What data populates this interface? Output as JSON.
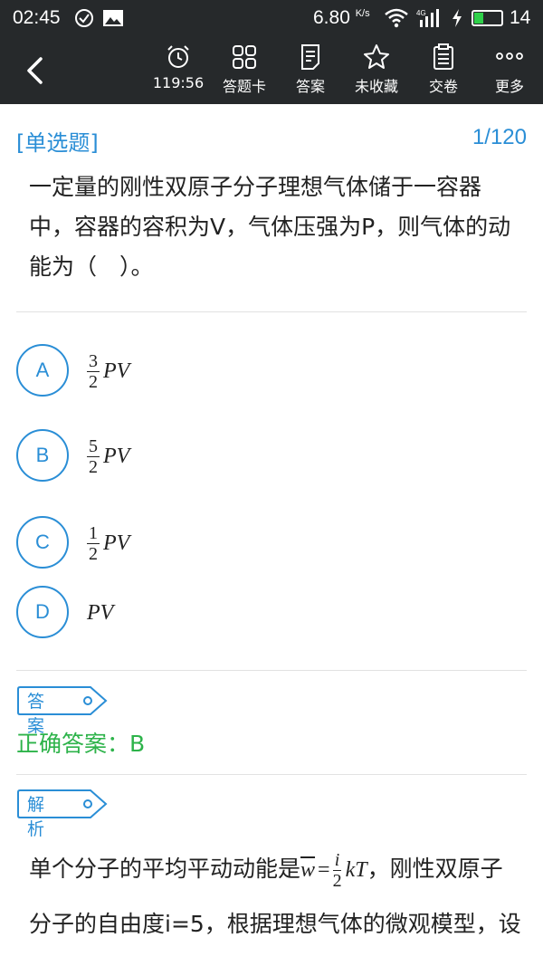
{
  "status": {
    "time": "02:45",
    "speed": "6.80",
    "speed_unit": "K/s",
    "battery": "14"
  },
  "toolbar": {
    "timer": "119:56",
    "answer_card": "答题卡",
    "answer": "答案",
    "favorite": "未收藏",
    "submit": "交卷",
    "more": "更多"
  },
  "question": {
    "type": "[单选题]",
    "index": "1/120",
    "text": "一定量的刚性双原子分子理想气体储于一容器中，容器的容积为V，气体压强为P，则气体的动能为（　）。"
  },
  "options": [
    {
      "letter": "A",
      "num": "3",
      "den": "2",
      "expr": "PV"
    },
    {
      "letter": "B",
      "num": "5",
      "den": "2",
      "expr": "PV"
    },
    {
      "letter": "C",
      "num": "1",
      "den": "2",
      "expr": "PV"
    },
    {
      "letter": "D",
      "expr": "PV"
    }
  ],
  "answer_tag": "答案",
  "correct_answer": "正确答案：B",
  "analysis_tag": "解析",
  "analysis": {
    "part1": "单个分子的平均平动动能是",
    "math_w": "w",
    "math_eq": "=",
    "math_num": "i",
    "math_den": "2",
    "math_kt": "kT",
    "part2": "，刚性双原子分子的自由度i=5，根据理想气体的微观模型，设分子总数是N，气体的动能"
  },
  "colors": {
    "accent": "#2a8ed6",
    "correct": "#2db34a",
    "bar": "#26292b"
  }
}
